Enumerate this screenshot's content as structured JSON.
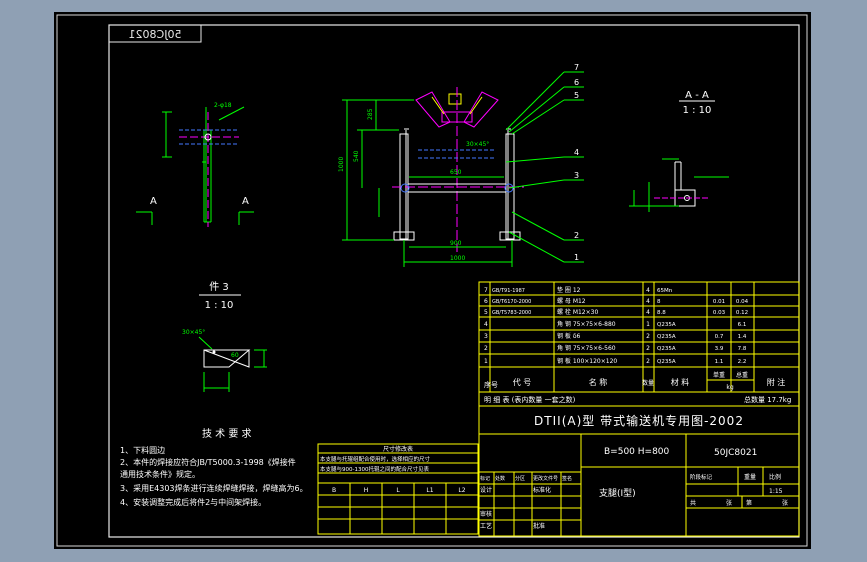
{
  "drawing": {
    "code_mirrored": "50JC8021",
    "drawing_no": "50JC8021",
    "spec": "B=500  H=800",
    "part_name": "支腿(I型)",
    "title": "DTII(A)型  带式输送机专用图-2002",
    "list_note": "明    细    表    (表内数量    一套之数)",
    "total_weight": "总数量 17.7kg",
    "scale_value": "1:15"
  },
  "views": {
    "section_label": "A - A",
    "section_scale": "1 : 10",
    "part_label": "件 3",
    "part_scale": "1 : 10",
    "a_left": "A",
    "a_right": "A",
    "bevel_note": "30×45°",
    "weld_note": "2-φ18",
    "dim_top": "285",
    "dim_left": "1000",
    "dim_mid": "540",
    "dim_inner": "650",
    "dim_900": "900",
    "dim_1000": "1000",
    "dim_small": "60"
  },
  "balloons": [
    "7",
    "6",
    "5",
    "4",
    "3",
    "2",
    "1"
  ],
  "tech": {
    "heading": "技 术 要 求",
    "items": [
      "1、下料圆边",
      "2、本件的焊接应符合JB/T5000.3-1998《焊接件",
      "    通用技术条件》规定。",
      "3、采用E4303焊条进行连续焊缝焊接，焊缝高为6。",
      "4、安装调整完成后将件2与中间架焊接。"
    ]
  },
  "bom": {
    "header": [
      "序号",
      "代  号",
      "名    称",
      "数量",
      "材  料",
      "单重",
      "总重",
      "附  注"
    ],
    "rows": [
      [
        "7",
        "GB/T91-1987",
        "垫  圈 12",
        "4",
        "65Mn",
        "",
        "",
        ""
      ],
      [
        "6",
        "GB/T6170-2000",
        "螺  母 M12",
        "4",
        "8",
        "",
        "0.01",
        "0.04"
      ],
      [
        "5",
        "GB/T5783-2000",
        "螺  栓 M12×30",
        "4",
        "8.8",
        "",
        "0.03",
        "0.12"
      ],
      [
        "4",
        "",
        "角  钢 75×75×6-880",
        "1",
        "Q235A",
        "",
        "",
        "6.1"
      ],
      [
        "3",
        "",
        "钢  板 δ6",
        "2",
        "Q235A",
        "",
        "0.7",
        "1.4"
      ],
      [
        "2",
        "",
        "角  钢 75×75×6-560",
        "2",
        "Q235A",
        "",
        "3.9",
        "7.8"
      ],
      [
        "1",
        "",
        "钢  板 100×120×120",
        "2",
        "Q235A",
        "",
        "1.1",
        "2.2"
      ]
    ],
    "unit_kg": "kg"
  },
  "change_table": {
    "title": "尺寸修改表",
    "notes": [
      "本支腿与托辊组配合使用时，选择相应的尺寸",
      "本支腿与900-1300托辊之间的配合尺寸见表"
    ],
    "headers": [
      "B",
      "H",
      "L",
      "L1",
      "L2"
    ],
    "rows": [
      [
        "",
        "",
        "",
        "",
        ""
      ],
      [
        "",
        "",
        "",
        "",
        ""
      ],
      [
        "",
        "",
        "",
        "",
        ""
      ],
      [
        "",
        "",
        "",
        "",
        ""
      ]
    ]
  },
  "title_block": {
    "labels": [
      "标记",
      "处数",
      "分区",
      "更改文件号",
      "签名",
      "年月日"
    ],
    "roles": [
      "设计",
      "审核",
      "工艺",
      "批准"
    ],
    "std": "标准化",
    "stage": "阶段标记",
    "weight": "重量",
    "scale": "比例",
    "sheets": "共",
    "sheet": "张",
    "of": "第"
  }
}
